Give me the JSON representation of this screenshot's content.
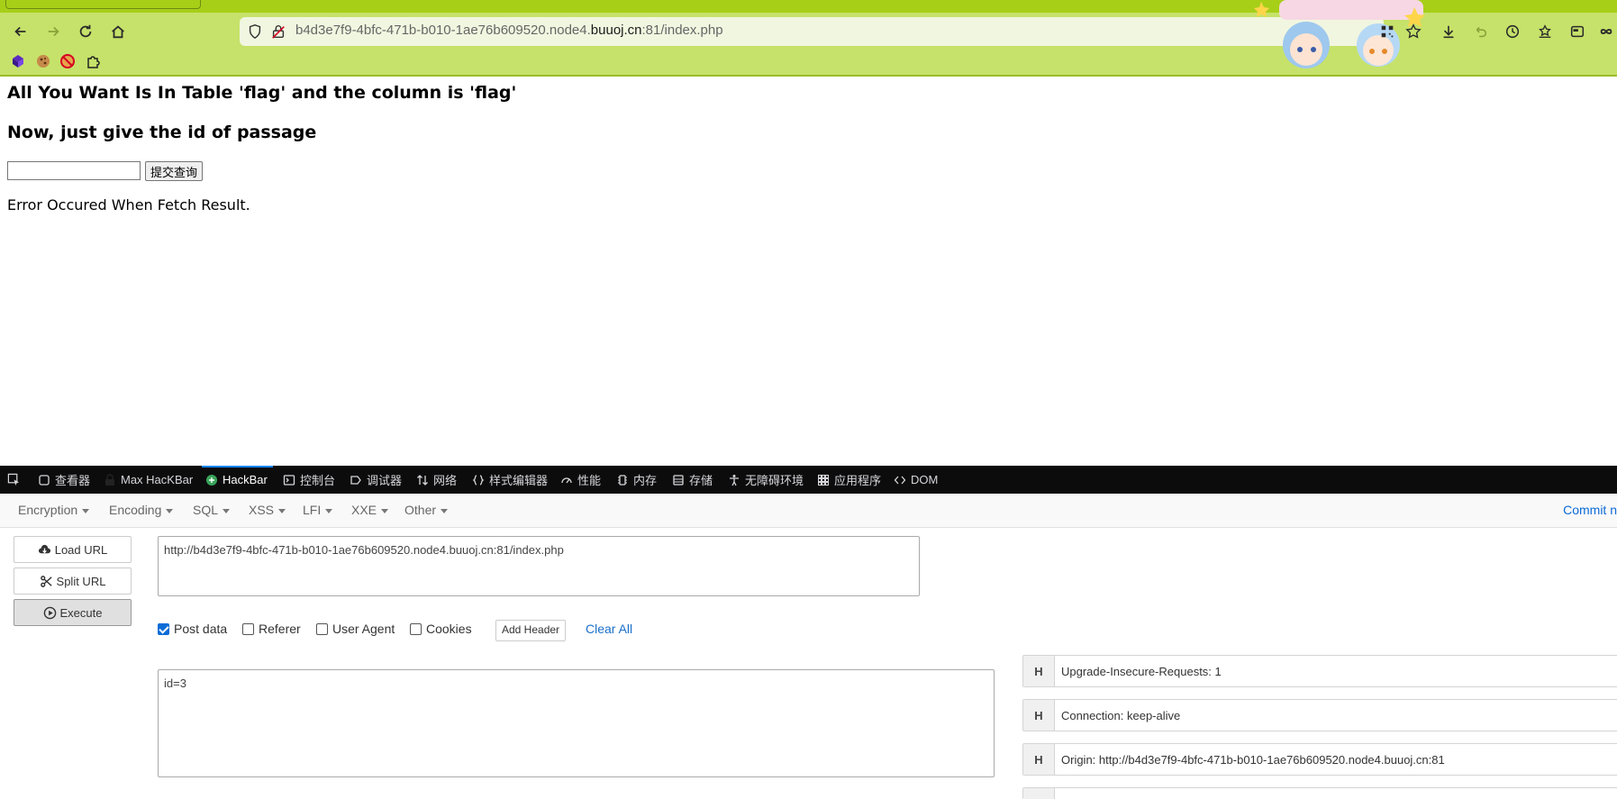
{
  "browser": {
    "url_prefix": "b4d3e7f9-4bfc-471b-b010-1ae76b609520.node4.",
    "url_host": "buuoj.cn",
    "url_suffix": ":81/index.php",
    "theme_color": "#c6e26a"
  },
  "page": {
    "heading1": "All You Want Is In Table 'flag' and the column is 'flag'",
    "heading2": "Now, just give the id of passage",
    "input_value": "",
    "submit_label": "提交查询",
    "message": "Error Occured When Fetch Result."
  },
  "devtools": {
    "tabs": [
      {
        "label": "查看器",
        "icon": "inspector-icon"
      },
      {
        "label": "Max HacKBar",
        "icon": "lock-icon"
      },
      {
        "label": "HackBar",
        "icon": "hackbar-icon",
        "active": true
      },
      {
        "label": "控制台",
        "icon": "console-icon"
      },
      {
        "label": "调试器",
        "icon": "debugger-icon"
      },
      {
        "label": "网络",
        "icon": "network-icon"
      },
      {
        "label": "样式编辑器",
        "icon": "braces-icon"
      },
      {
        "label": "性能",
        "icon": "gauge-icon"
      },
      {
        "label": "内存",
        "icon": "memory-icon"
      },
      {
        "label": "存储",
        "icon": "storage-icon"
      },
      {
        "label": "无障碍环境",
        "icon": "accessibility-icon"
      },
      {
        "label": "应用程序",
        "icon": "grid-icon"
      },
      {
        "label": "DOM",
        "icon": "code-icon"
      }
    ]
  },
  "hackbar": {
    "menu": [
      "Encryption",
      "Encoding",
      "SQL",
      "XSS",
      "LFI",
      "XXE",
      "Other"
    ],
    "commit_label": "Commit n",
    "buttons": {
      "load": "Load URL",
      "split": "Split URL",
      "execute": "Execute"
    },
    "url": "http://b4d3e7f9-4bfc-471b-b010-1ae76b609520.node4.buuoj.cn:81/index.php",
    "options": {
      "post_data": {
        "label": "Post data",
        "checked": true
      },
      "referer": {
        "label": "Referer",
        "checked": false
      },
      "user_agent": {
        "label": "User Agent",
        "checked": false
      },
      "cookies": {
        "label": "Cookies",
        "checked": false
      }
    },
    "add_header_label": "Add Header",
    "clear_all_label": "Clear All",
    "post_body": "id=3",
    "headers": [
      {
        "key": "H",
        "value": "Upgrade-Insecure-Requests: 1"
      },
      {
        "key": "H",
        "value": "Connection: keep-alive"
      },
      {
        "key": "H",
        "value": "Origin: http://b4d3e7f9-4bfc-471b-b010-1ae76b609520.node4.buuoj.cn:81"
      }
    ]
  }
}
